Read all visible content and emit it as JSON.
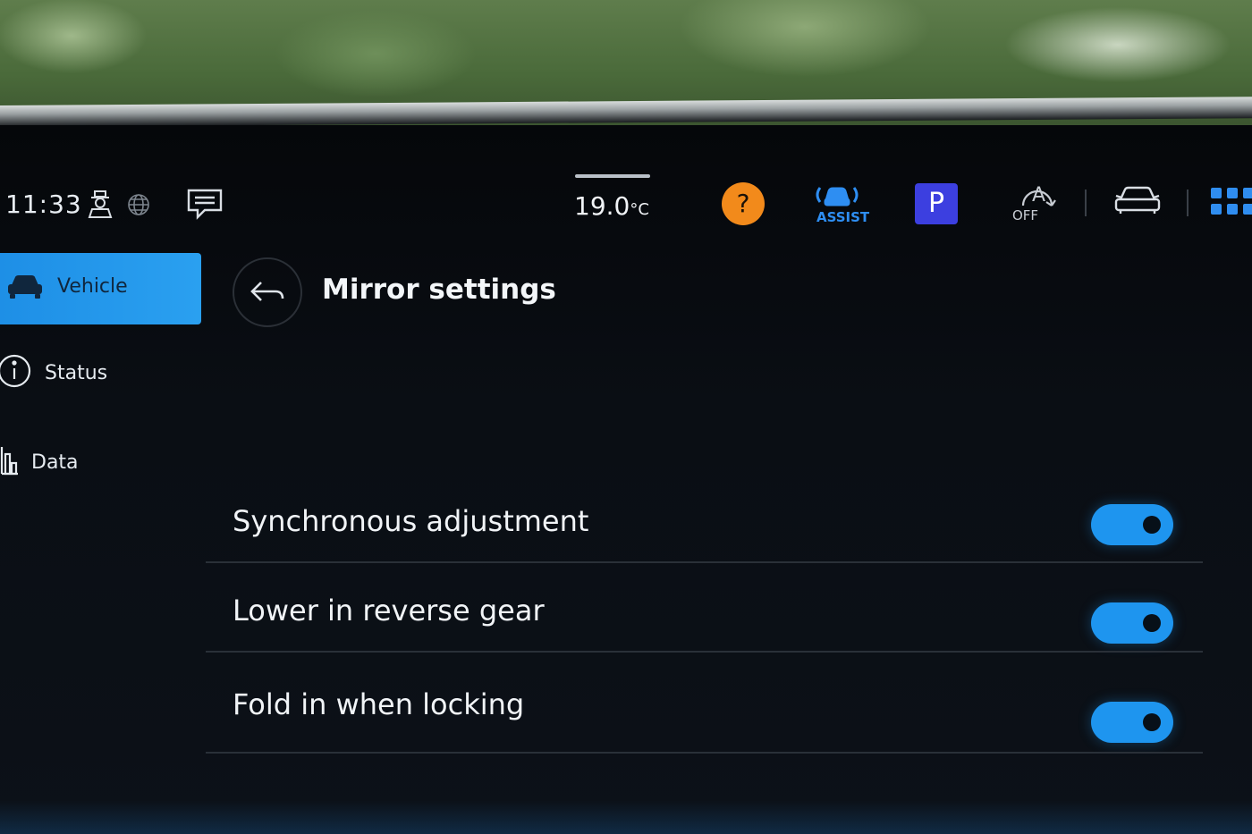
{
  "status_bar": {
    "time": "11:33",
    "temperature_value": "19.0",
    "temperature_unit": "°C",
    "help_label": "?",
    "assist_label": "ASSIST",
    "park_label": "P",
    "autohold_label": "A",
    "autohold_state": "OFF",
    "accent_color": "#2e8ef2",
    "help_color": "#f28a1b",
    "park_color": "#3c3fe0"
  },
  "sidebar": {
    "items": [
      {
        "label": "Vehicle",
        "icon": "car-icon",
        "active": true
      },
      {
        "label": "Status",
        "icon": "info-icon",
        "active": false
      },
      {
        "label": "Data",
        "icon": "bar-chart-icon",
        "active": false
      }
    ]
  },
  "main": {
    "title": "Mirror settings",
    "settings": [
      {
        "label": "Synchronous adjustment",
        "enabled": true
      },
      {
        "label": "Lower in reverse gear",
        "enabled": true
      },
      {
        "label": "Fold in when locking",
        "enabled": true
      }
    ]
  }
}
